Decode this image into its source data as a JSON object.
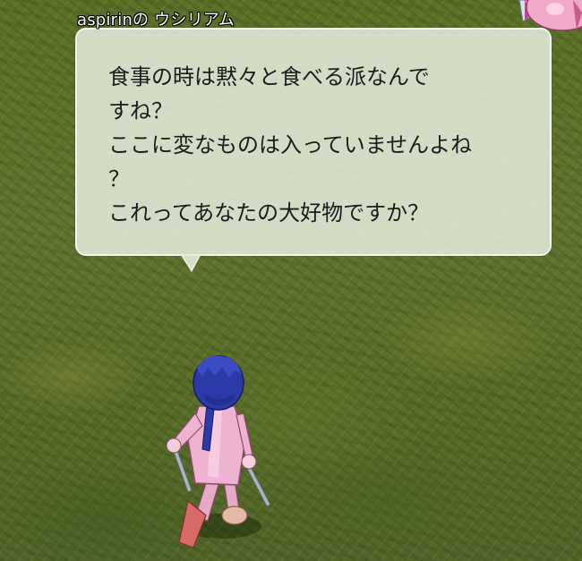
{
  "chat": {
    "speaker_name": "aspirinの ウシリアム",
    "message_lines": [
      "食事の時は黙々と食べる派なんで",
      "すね？",
      "ここに変なものは入っていませんよね",
      "？",
      "これってあなたの大好物ですか？"
    ]
  },
  "colors": {
    "grass": "#5c7027",
    "bubble_fill": "#e4ebda",
    "text": "#1c1c1c",
    "name_tag": "#ffffff",
    "hair": "#2b3aa8",
    "outfit": "#e8a9c8"
  },
  "icons": {
    "player_character": "blue-haired-pink-outfit-character",
    "partial_character": "pink-character-corner"
  }
}
